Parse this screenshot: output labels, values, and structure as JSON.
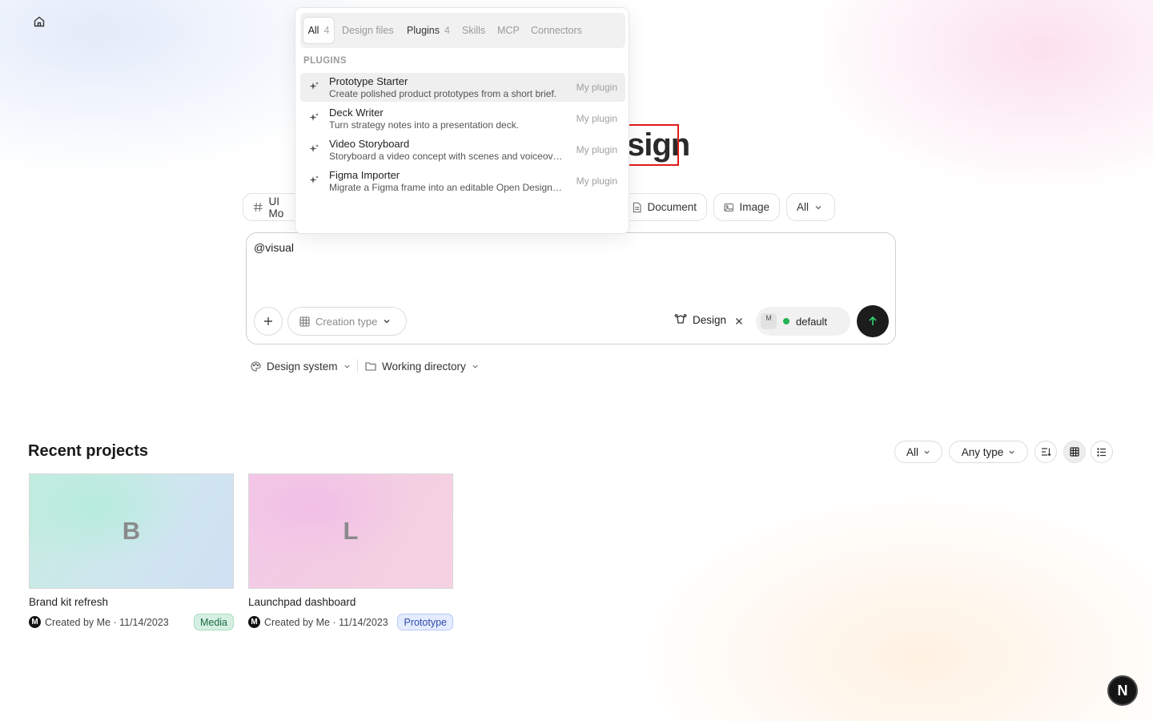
{
  "hero": {
    "title_fragment": "sign"
  },
  "chips": {
    "ui_mockup": "UI Mo",
    "document": "Document",
    "image": "Image",
    "all": "All"
  },
  "composer": {
    "text": "@visual",
    "creation_type_placeholder": "Creation type",
    "design_tag": "Design",
    "model_avatar": "M",
    "model_name": "default"
  },
  "controls": {
    "design_system": "Design system",
    "working_directory": "Working directory"
  },
  "dropdown": {
    "tabs": [
      {
        "label": "All",
        "count": "4"
      },
      {
        "label": "Design files",
        "count": ""
      },
      {
        "label": "Plugins",
        "count": "4"
      },
      {
        "label": "Skills",
        "count": ""
      },
      {
        "label": "MCP",
        "count": ""
      },
      {
        "label": "Connectors",
        "count": ""
      }
    ],
    "section": "PLUGINS",
    "plugins": [
      {
        "title": "Prototype Starter",
        "desc": "Create polished product prototypes from a short brief.",
        "owner": "My plugin"
      },
      {
        "title": "Deck Writer",
        "desc": "Turn strategy notes into a presentation deck.",
        "owner": "My plugin"
      },
      {
        "title": "Video Storyboard",
        "desc": "Storyboard a video concept with scenes and voiceover.",
        "owner": "My plugin"
      },
      {
        "title": "Figma Importer",
        "desc": "Migrate a Figma frame into an editable Open Design file.",
        "owner": "My plugin"
      }
    ]
  },
  "recent": {
    "title": "Recent projects",
    "filter_all": "All",
    "filter_type": "Any type",
    "projects": [
      {
        "initial": "B",
        "name": "Brand kit refresh",
        "avatar": "M",
        "meta": "Created by Me · 11/14/2023",
        "badge": "Media"
      },
      {
        "initial": "L",
        "name": "Launchpad dashboard",
        "avatar": "M",
        "meta": "Created by Me · 11/14/2023",
        "badge": "Prototype"
      }
    ]
  },
  "framework_badge": "N"
}
